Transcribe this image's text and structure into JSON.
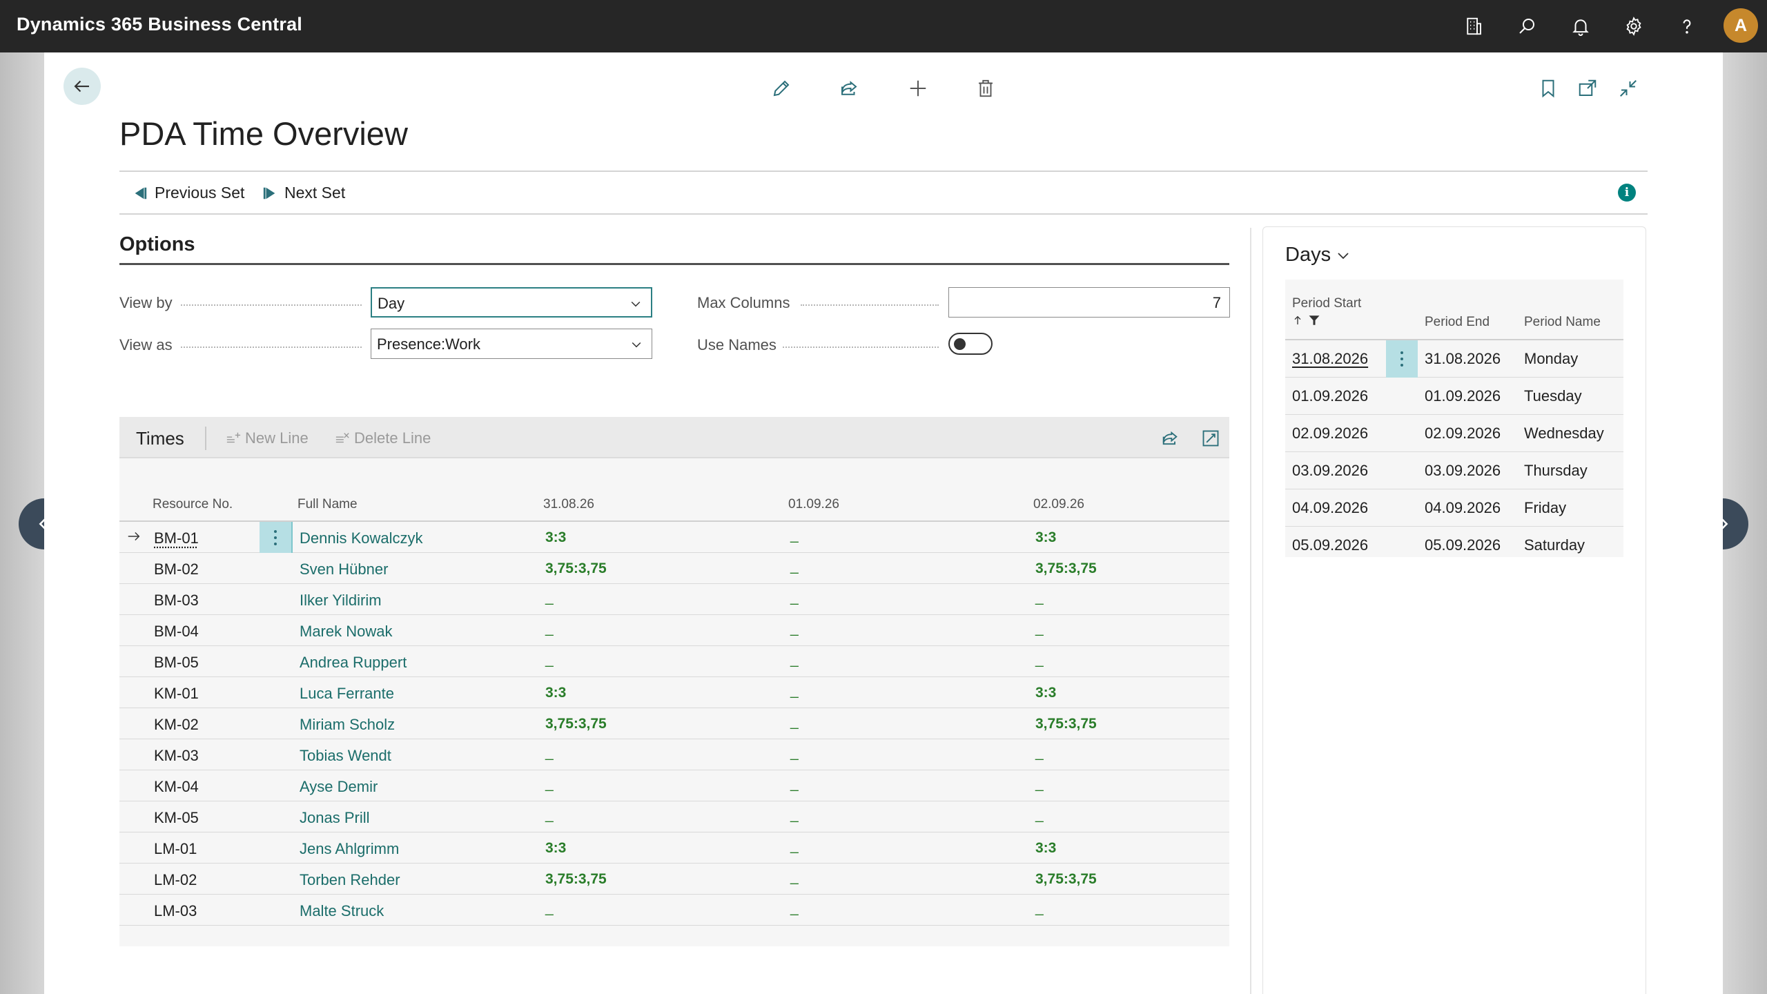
{
  "app": {
    "title": "Dynamics 365 Business Central",
    "user_initial": "A"
  },
  "page": {
    "title": "PDA Time Overview"
  },
  "actions": {
    "previous_set": "Previous Set",
    "next_set": "Next Set"
  },
  "options": {
    "title": "Options",
    "view_by_label": "View by",
    "view_by_value": "Day",
    "view_as_label": "View as",
    "view_as_value": "Presence:Work",
    "max_columns_label": "Max Columns",
    "max_columns_value": "7",
    "use_names_label": "Use Names",
    "use_names_value": false
  },
  "times": {
    "title": "Times",
    "new_line": "New Line",
    "delete_line": "Delete Line",
    "columns": [
      "Resource No.",
      "Full Name",
      "31.08.26",
      "01.09.26",
      "02.09.26"
    ],
    "rows": [
      {
        "no": "BM-01",
        "name": "Dennis Kowalczyk",
        "d1": "3:3",
        "d2": "_",
        "d3": "3:3",
        "current": true
      },
      {
        "no": "BM-02",
        "name": "Sven Hübner",
        "d1": "3,75:3,75",
        "d2": "_",
        "d3": "3,75:3,75"
      },
      {
        "no": "BM-03",
        "name": "Ilker Yildirim",
        "d1": "_",
        "d2": "_",
        "d3": "_"
      },
      {
        "no": "BM-04",
        "name": "Marek Nowak",
        "d1": "_",
        "d2": "_",
        "d3": "_"
      },
      {
        "no": "BM-05",
        "name": "Andrea Ruppert",
        "d1": "_",
        "d2": "_",
        "d3": "_"
      },
      {
        "no": "KM-01",
        "name": "Luca Ferrante",
        "d1": "3:3",
        "d2": "_",
        "d3": "3:3"
      },
      {
        "no": "KM-02",
        "name": "Miriam Scholz",
        "d1": "3,75:3,75",
        "d2": "_",
        "d3": "3,75:3,75"
      },
      {
        "no": "KM-03",
        "name": "Tobias Wendt",
        "d1": "_",
        "d2": "_",
        "d3": "_"
      },
      {
        "no": "KM-04",
        "name": "Ayse Demir",
        "d1": "_",
        "d2": "_",
        "d3": "_"
      },
      {
        "no": "KM-05",
        "name": "Jonas Prill",
        "d1": "_",
        "d2": "_",
        "d3": "_"
      },
      {
        "no": "LM-01",
        "name": "Jens Ahlgrimm",
        "d1": "3:3",
        "d2": "_",
        "d3": "3:3"
      },
      {
        "no": "LM-02",
        "name": "Torben Rehder",
        "d1": "3,75:3,75",
        "d2": "_",
        "d3": "3,75:3,75"
      },
      {
        "no": "LM-03",
        "name": "Malte Struck",
        "d1": "_",
        "d2": "_",
        "d3": "_"
      }
    ]
  },
  "days": {
    "title": "Days",
    "columns": [
      "Period Start",
      "Period End",
      "Period Name"
    ],
    "rows": [
      {
        "start": "31.08.2026",
        "end": "31.08.2026",
        "name": "Monday",
        "current": true
      },
      {
        "start": "01.09.2026",
        "end": "01.09.2026",
        "name": "Tuesday"
      },
      {
        "start": "02.09.2026",
        "end": "02.09.2026",
        "name": "Wednesday"
      },
      {
        "start": "03.09.2026",
        "end": "03.09.2026",
        "name": "Thursday"
      },
      {
        "start": "04.09.2026",
        "end": "04.09.2026",
        "name": "Friday"
      },
      {
        "start": "05.09.2026",
        "end": "05.09.2026",
        "name": "Saturday"
      }
    ]
  },
  "colors": {
    "accent": "#00827f",
    "link": "#1b6d6a",
    "value_green": "#2a7d2a",
    "appbar": "#262626",
    "avatar": "#c6882c"
  }
}
